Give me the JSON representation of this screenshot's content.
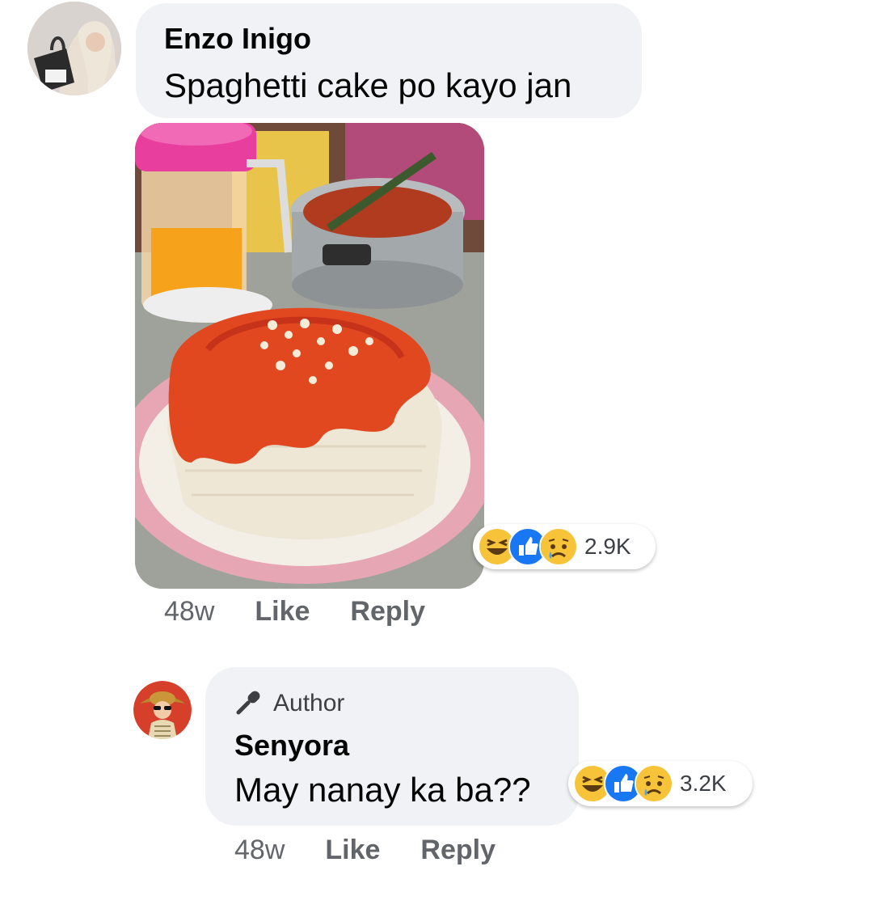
{
  "comments": [
    {
      "author": "Enzo Inigo",
      "text": "Spaghetti cake po kayo jan",
      "reactions": {
        "icons": [
          "haha-icon",
          "like-icon",
          "sad-icon"
        ],
        "count": "2.9K"
      },
      "time": "48w",
      "like_label": "Like",
      "reply_label": "Reply"
    },
    {
      "badge": "Author",
      "author": "Senyora",
      "text": "May nanay ka ba??",
      "reactions": {
        "icons": [
          "haha-icon",
          "like-icon",
          "sad-icon"
        ],
        "count": "3.2K"
      },
      "time": "48w",
      "like_label": "Like",
      "reply_label": "Reply"
    }
  ],
  "colors": {
    "bubble": "#f0f2f5",
    "secondary_text": "#62656a",
    "like_blue": "#1877f2",
    "emoji_yellow": "#f7c338"
  }
}
